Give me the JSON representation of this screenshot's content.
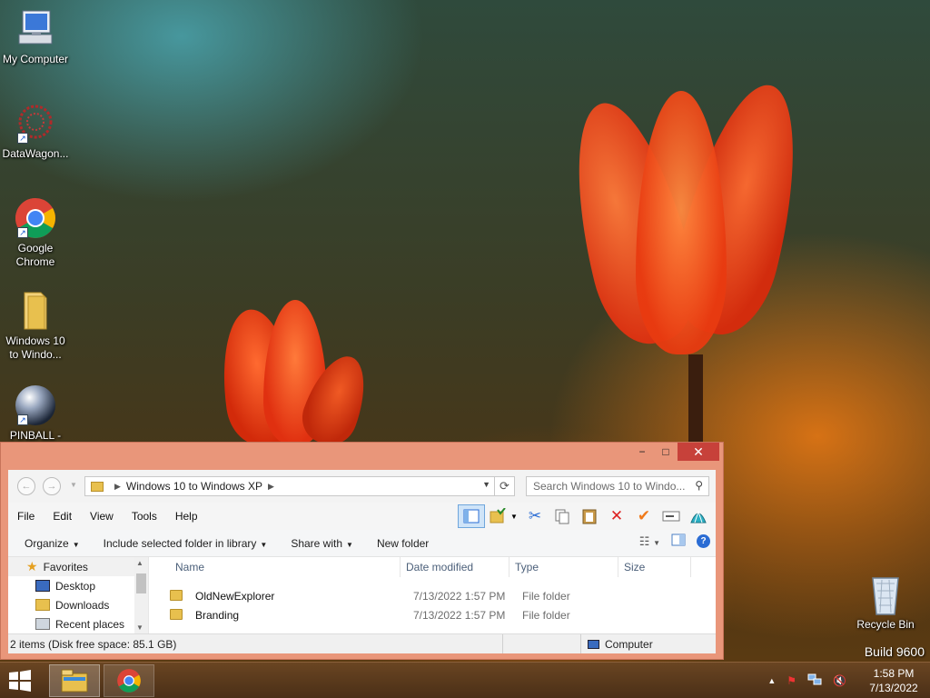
{
  "desktop": {
    "icons": [
      {
        "label": "My Computer"
      },
      {
        "label": "DataWagon..."
      },
      {
        "label": "Google Chrome"
      },
      {
        "label": "Windows 10 to Windo..."
      },
      {
        "label": "PINBALL -"
      },
      {
        "label": "Recycle Bin"
      }
    ],
    "build": "Build 9600"
  },
  "window": {
    "minimize_glyph": "−",
    "maximize_glyph": "□",
    "close_glyph": "✕",
    "back_glyph": "←",
    "forward_glyph": "→",
    "breadcrumb": "Windows 10 to Windows XP",
    "search_placeholder": "Search Windows 10 to Windo...",
    "menu": [
      "File",
      "Edit",
      "View",
      "Tools",
      "Help"
    ],
    "commands": {
      "organize": "Organize",
      "include": "Include selected folder in library",
      "share": "Share with",
      "new_folder": "New folder"
    },
    "nav": {
      "favorites": "Favorites",
      "desktop": "Desktop",
      "downloads": "Downloads",
      "recent": "Recent places"
    },
    "columns": [
      "Name",
      "Date modified",
      "Type",
      "Size"
    ],
    "files": [
      {
        "name": "OldNewExplorer",
        "date": "7/13/2022 1:57 PM",
        "type": "File folder",
        "size": ""
      },
      {
        "name": "Branding",
        "date": "7/13/2022 1:57 PM",
        "type": "File folder",
        "size": ""
      }
    ],
    "status": {
      "items": "2 items (Disk free space: 85.1 GB)",
      "location": "Computer"
    }
  },
  "taskbar": {
    "time": "1:58 PM",
    "date": "7/13/2022"
  },
  "colors": {
    "window_frame": "#e9967a",
    "close_button": "#c7413a",
    "taskbar": "#4a2f17"
  }
}
